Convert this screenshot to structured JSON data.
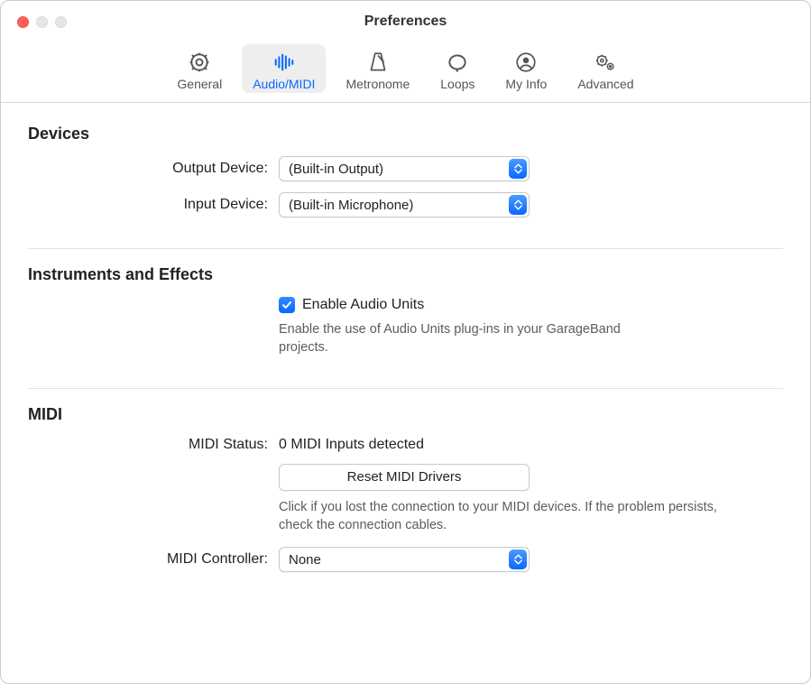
{
  "window": {
    "title": "Preferences"
  },
  "tabs": {
    "general": {
      "label": "General"
    },
    "audiomidi": {
      "label": "Audio/MIDI"
    },
    "metronome": {
      "label": "Metronome"
    },
    "loops": {
      "label": "Loops"
    },
    "myinfo": {
      "label": "My Info"
    },
    "advanced": {
      "label": "Advanced"
    }
  },
  "sections": {
    "devices": {
      "title": "Devices",
      "output_label": "Output Device:",
      "output_value": "(Built-in Output)",
      "input_label": "Input Device:",
      "input_value": "(Built-in Microphone)"
    },
    "instruments": {
      "title": "Instruments and Effects",
      "enable_au_label": "Enable Audio Units",
      "enable_au_checked": true,
      "enable_au_desc": "Enable the use of Audio Units plug-ins in your GarageBand projects."
    },
    "midi": {
      "title": "MIDI",
      "status_label": "MIDI Status:",
      "status_value": "0 MIDI Inputs detected",
      "reset_button": "Reset MIDI Drivers",
      "reset_desc": "Click if you lost the connection to your MIDI devices. If the problem persists, check the connection cables.",
      "controller_label": "MIDI Controller:",
      "controller_value": "None"
    }
  }
}
